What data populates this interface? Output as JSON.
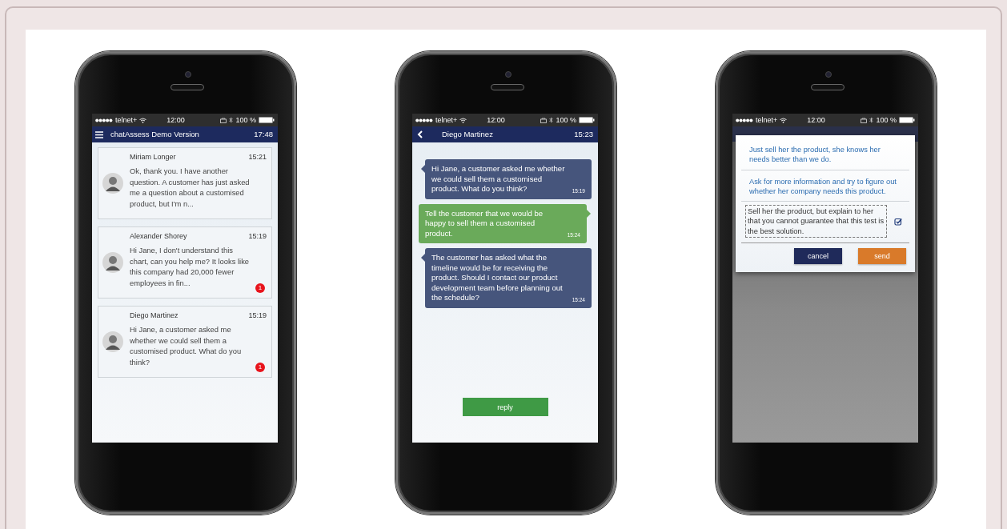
{
  "phones": [
    {
      "kind": "inbox",
      "status_bar": {
        "carrier": "telnet+",
        "time": "12:00",
        "battery": "100 %"
      },
      "header": {
        "title": "chatAssess Demo Version",
        "time": "17:48"
      },
      "conversations": [
        {
          "name": "Miriam Longer",
          "time": "15:21",
          "preview": "Ok, thank you. I have another question. A customer has just asked me a question about a customised product, but I'm n..."
        },
        {
          "name": "Alexander Shorey",
          "time": "15:19",
          "preview": "Hi Jane, I don't understand this chart, can you help me? It looks like this company had 20,000 fewer employees in fin...",
          "unread": "1"
        },
        {
          "name": "Diego Martinez",
          "time": "15:19",
          "preview": "Hi Jane, a customer asked me whether we could sell them a customised product. What do you think?",
          "unread": "1"
        }
      ]
    },
    {
      "kind": "chat",
      "status_bar": {
        "carrier": "telnet+",
        "time": "12:00",
        "battery": "100 %"
      },
      "header": {
        "title": "Diego Martinez",
        "time": "15:23"
      },
      "messages": [
        {
          "kind": "incoming",
          "text": "Hi Jane, a customer asked me whether we could sell them a customised product. What do you think?",
          "time": "15:19"
        },
        {
          "kind": "outgoing",
          "text": "Tell the customer that we would be happy to sell them a customised product.",
          "time": "15:24"
        },
        {
          "kind": "incoming",
          "text": "The customer has asked what the timeline would be for receiving the product. Should I contact our product development team before planning out the schedule?",
          "time": "15:24"
        }
      ],
      "reply_button": "reply"
    },
    {
      "kind": "answer",
      "status_bar": {
        "carrier": "telnet+",
        "time": "12:00",
        "battery": "100 %"
      },
      "options": [
        {
          "text": "Just sell her the product, she knows her needs better than we do.",
          "selected": false
        },
        {
          "text": "Ask for more information and try to figure out whether her company needs this product.",
          "selected": false
        },
        {
          "text": "Sell her the product, but explain to her that you cannot guarantee that this test is the best solution.",
          "selected": true
        }
      ],
      "cancel_button": "cancel",
      "send_button": "send"
    }
  ]
}
